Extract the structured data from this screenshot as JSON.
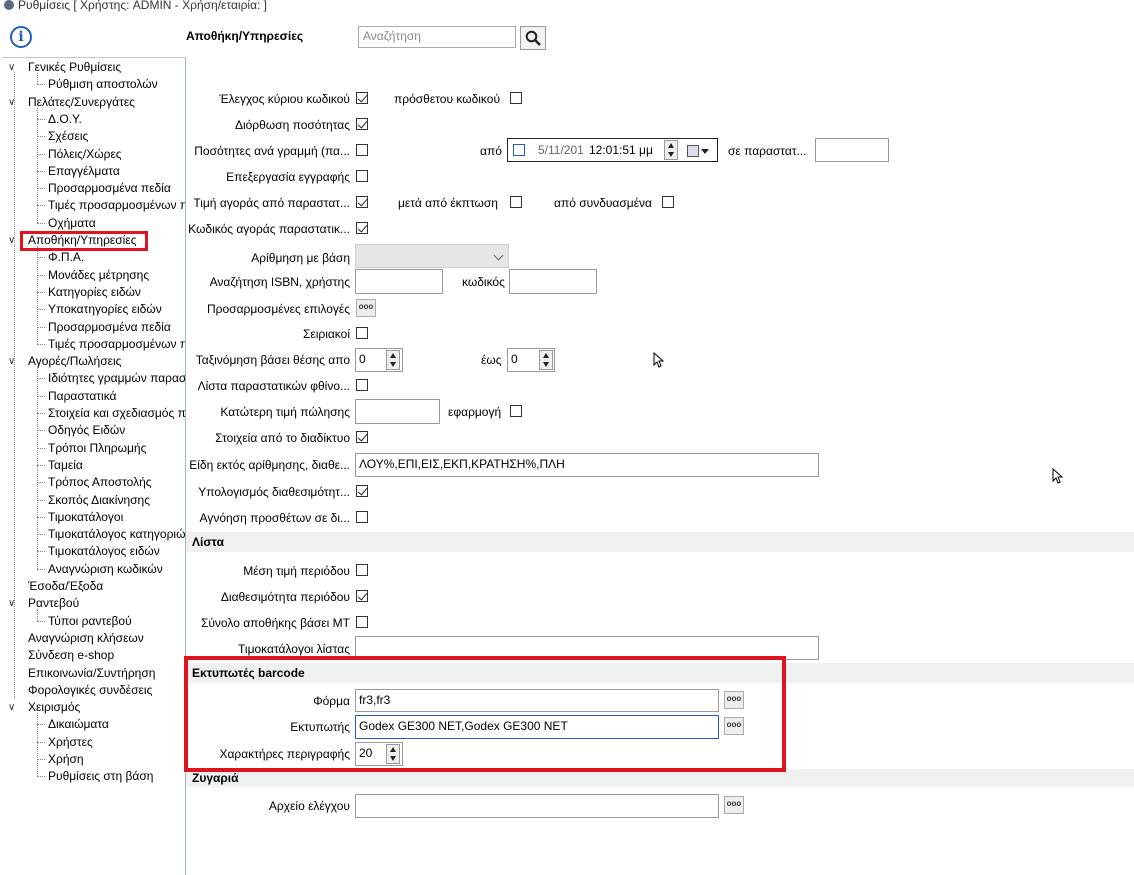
{
  "window": {
    "title": "Ρυθμίσεις   [ Χρήστης: ADMIN - Χρήση/εταιρία:  ]"
  },
  "header": {
    "title": "Αποθήκη/Υπηρεσίες",
    "search_placeholder": "Αναζήτηση"
  },
  "tree": [
    {
      "label": "Γενικές Ρυθμίσεις",
      "level": 0,
      "expanded": true
    },
    {
      "label": "Ρύθμιση αποστολών",
      "level": 1
    },
    {
      "label": "Πελάτες/Συνεργάτες",
      "level": 0,
      "expanded": true
    },
    {
      "label": "Δ.Ο.Υ.",
      "level": 1
    },
    {
      "label": "Σχέσεις",
      "level": 1
    },
    {
      "label": "Πόλεις/Χώρες",
      "level": 1
    },
    {
      "label": "Επαγγέλματα",
      "level": 1
    },
    {
      "label": "Προσαρμοσμένα πεδία",
      "level": 1
    },
    {
      "label": "Τιμές προσαρμοσμένων π",
      "level": 1
    },
    {
      "label": "Οχήματα",
      "level": 1
    },
    {
      "label": "Αποθήκη/Υπηρεσίες",
      "level": 0,
      "expanded": true,
      "selected": true
    },
    {
      "label": "Φ.Π.Α.",
      "level": 1
    },
    {
      "label": "Μονάδες μέτρησης",
      "level": 1
    },
    {
      "label": "Κατηγορίες ειδών",
      "level": 1
    },
    {
      "label": "Υποκατηγορίες ειδών",
      "level": 1
    },
    {
      "label": "Προσαρμοσμένα πεδία",
      "level": 1
    },
    {
      "label": "Τιμές προσαρμοσμένων π",
      "level": 1
    },
    {
      "label": "Αγορές/Πωλήσεις",
      "level": 0,
      "expanded": true
    },
    {
      "label": "Ιδιότητες γραμμών παρασ",
      "level": 1
    },
    {
      "label": "Παραστατικά",
      "level": 1
    },
    {
      "label": "Στοιχεία και σχεδιασμός π",
      "level": 1
    },
    {
      "label": "Οδηγός Ειδών",
      "level": 1
    },
    {
      "label": "Τρόποι Πληρωμής",
      "level": 1
    },
    {
      "label": "Ταμεία",
      "level": 1
    },
    {
      "label": "Τρόπος Αποστολής",
      "level": 1
    },
    {
      "label": "Σκοπός Διακίνησης",
      "level": 1
    },
    {
      "label": "Τιμοκατάλογοι",
      "level": 1
    },
    {
      "label": "Τιμοκατάλογος κατηγοριώ",
      "level": 1
    },
    {
      "label": "Τιμοκατάλογος ειδών",
      "level": 1
    },
    {
      "label": "Αναγνώριση κωδικών",
      "level": 1
    },
    {
      "label": "Έσοδα/Έξοδα",
      "level": 0
    },
    {
      "label": "Ραντεβού",
      "level": 0,
      "expanded": true
    },
    {
      "label": "Τύποι ραντεβού",
      "level": 1
    },
    {
      "label": "Αναγνώριση κλήσεων",
      "level": 0
    },
    {
      "label": "Σύνδεση e-shop",
      "level": 0
    },
    {
      "label": "Επικοινωνία/Συντήρηση",
      "level": 0
    },
    {
      "label": "Φορολογικές συνδέσεις",
      "level": 0
    },
    {
      "label": "Χειρισμός",
      "level": 0,
      "expanded": true
    },
    {
      "label": "Δικαιώματα",
      "level": 1
    },
    {
      "label": "Χρήστες",
      "level": 1
    },
    {
      "label": "Χρήση",
      "level": 1
    },
    {
      "label": "Ρυθμίσεις στη βάση",
      "level": 1
    }
  ],
  "form": {
    "kyriou_kodikou": {
      "label": "Έλεγχος κύριου κωδικού",
      "checked": true
    },
    "prosthetou_kodikou": {
      "label": "πρόσθετου κωδικού",
      "checked": false
    },
    "diorthosi_posotitas": {
      "label": "Διόρθωση ποσότητας",
      "checked": true
    },
    "posotites_ana_grammi": {
      "label": "Ποσότητες ανά γραμμή (πα...",
      "checked": false
    },
    "apo_label": "από",
    "date_value": "5/11/201",
    "time_value": "12:01:51 μμ",
    "se_parastatika_label": "σε παραστατ...",
    "epeksergasia_eggrafis": {
      "label": "Επεξεργασία εγγραφής",
      "checked": false
    },
    "timi_agoras": {
      "label": "Τιμή αγοράς από παραστατ...",
      "checked": true
    },
    "meta_ekptosi": {
      "label": "μετά από έκπτωση",
      "checked": false
    },
    "apo_syndyasmena": {
      "label": "από συνδυασμένα",
      "checked": false
    },
    "kodikos_agoras": {
      "label": "Κωδικός αγοράς παραστατικ...",
      "checked": true
    },
    "arithmisi_label": "Αρίθμηση με βάση",
    "isbn_label": "Αναζήτηση ISBN, χρήστης",
    "kodikos_label": "κωδικός",
    "prosarmosmenes_label": "Προσαρμοσμένες επιλογές",
    "seiriakoi": {
      "label": "Σειριακοί",
      "checked": false
    },
    "taksinomisi_label": "Ταξινόμηση βάσει θέσης απο",
    "taksinomisi_from": "0",
    "eos_label": "έως",
    "taksinomisi_to": "0",
    "lista_fthinousas": {
      "label": "Λίστα παραστατικών φθίνο...",
      "checked": false
    },
    "katoteri_timi_label": "Κατώτερη τιμή πώλησης",
    "efarmogi": {
      "label": "εφαρμογή",
      "checked": false
    },
    "stoixeia_diadiktyo": {
      "label": "Στοιχεία από το διαδίκτυο",
      "checked": true
    },
    "eidi_ektos_label": "Είδη εκτός αρίθμησης, διαθε...",
    "eidi_ektos_value": "ΛΟΥ%,ΕΠΙ,ΕΙΣ,ΕΚΠ,ΚΡΑΤΗΣΗ%,ΠΛΗ",
    "ypologismos": {
      "label": "Υπολογισμός διαθεσιμότητ...",
      "checked": true
    },
    "agnoisi": {
      "label": "Αγνόηση προσθέτων σε δι...",
      "checked": false
    }
  },
  "lista": {
    "section_title": "Λίστα",
    "mesi_timi": {
      "label": "Μέση τιμή περιόδου",
      "checked": false
    },
    "diathesimotita": {
      "label": "Διαθεσιμότητα περιόδου",
      "checked": true
    },
    "synolo_apothikis": {
      "label": "Σύνολο αποθήκης βάσει ΜΤ",
      "checked": false
    },
    "timokatalogoi_label": "Τιμοκατάλογοι λίστας"
  },
  "barcode": {
    "section_title": "Εκτυπωτές barcode",
    "forma_label": "Φόρμα",
    "forma_value": "fr3,fr3",
    "ektypotis_label": "Εκτυπωτής",
    "ektypotis_value": "Godex GE300 NET,Godex GE300 NET",
    "xaraktires_label": "Χαρακτήρες περιγραφής",
    "xaraktires_value": "20"
  },
  "zygaria": {
    "section_title": "Ζυγαριά",
    "arxeio_label": "Αρχείο ελέγχου"
  },
  "buttons": {
    "dots": "ooo"
  },
  "colors": {
    "highlight": "#e0141e",
    "info": "#1f5fbf"
  }
}
